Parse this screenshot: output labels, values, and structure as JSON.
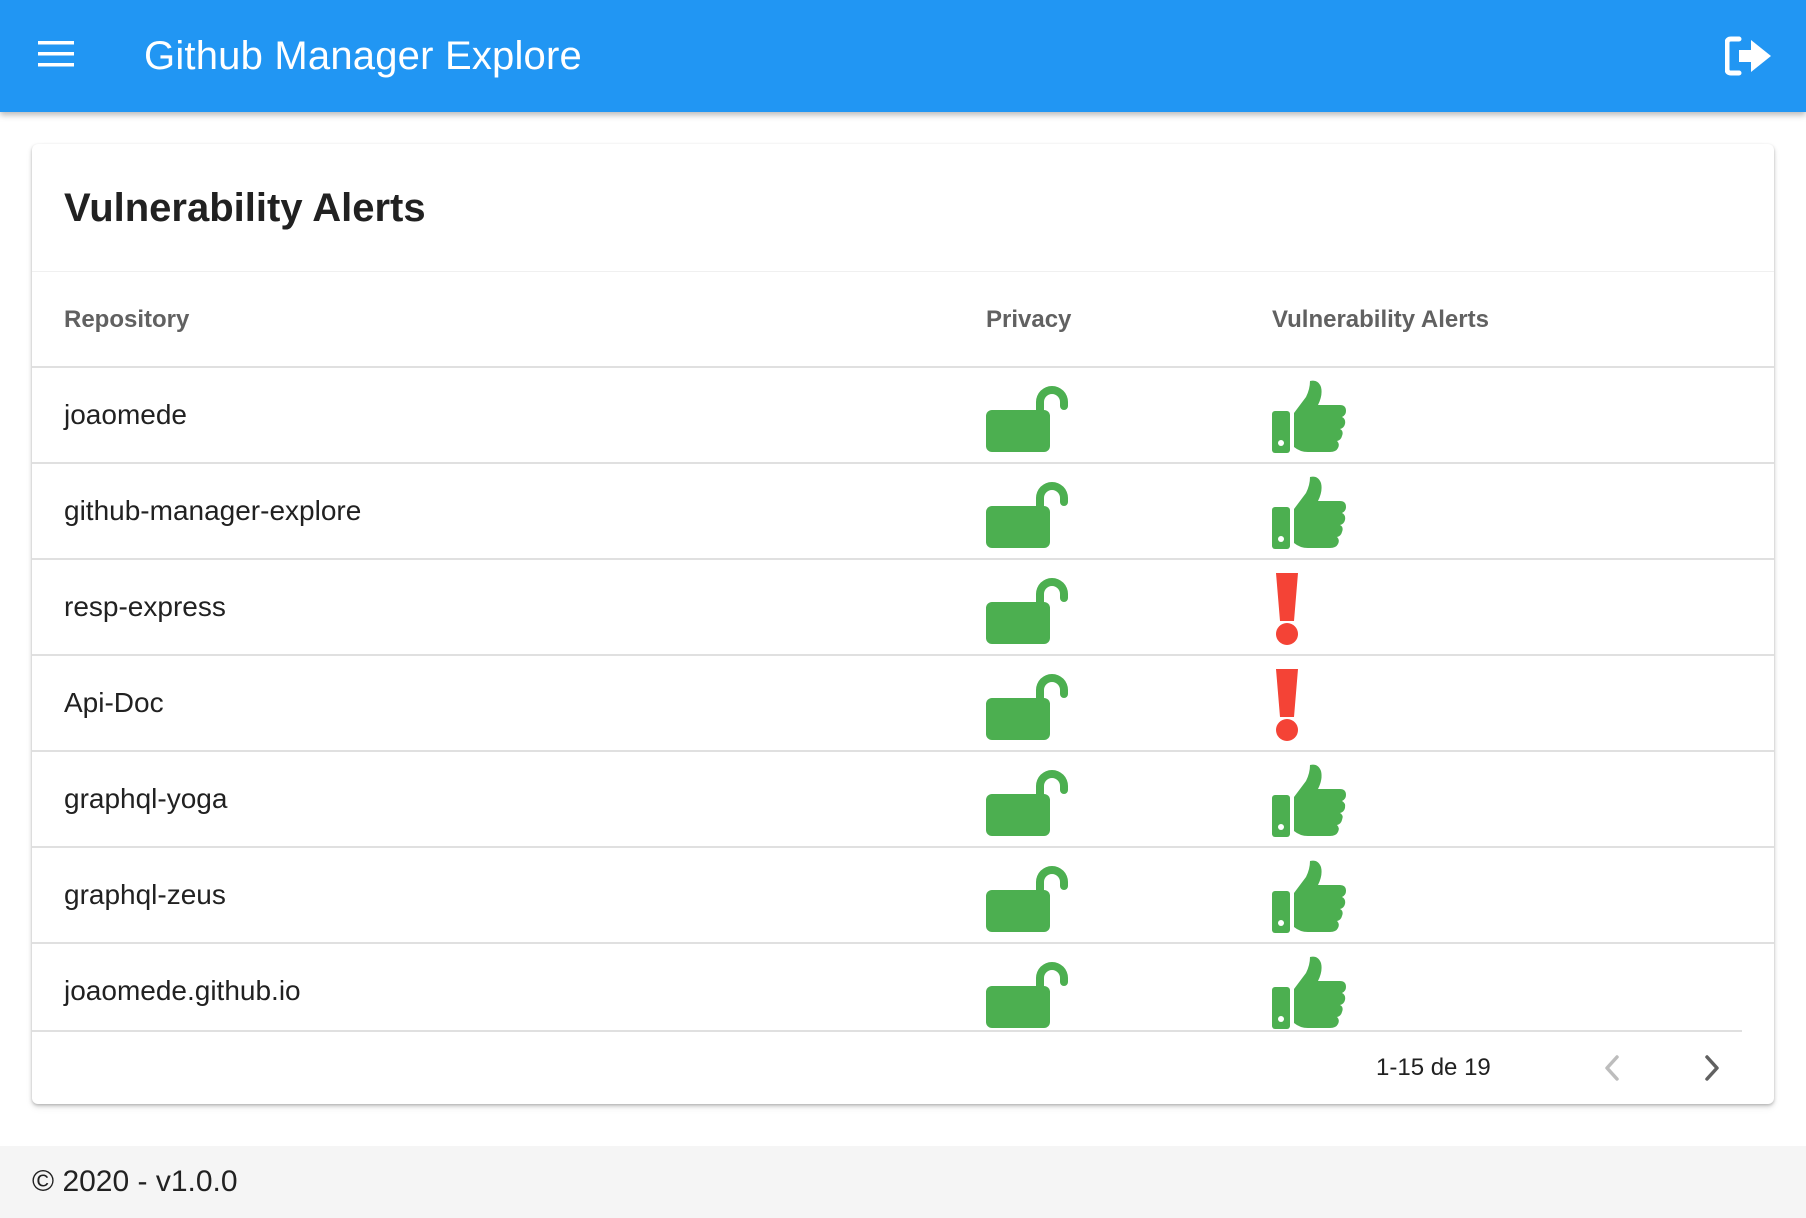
{
  "appbar": {
    "title": "Github Manager Explore",
    "menu_icon": "hamburger-menu-icon",
    "logout_icon": "sign-out-icon",
    "color": "#2196f3"
  },
  "card": {
    "title": "Vulnerability Alerts"
  },
  "table": {
    "headers": {
      "repository": "Repository",
      "privacy": "Privacy",
      "vulnerability": "Vulnerability Alerts"
    },
    "rows": [
      {
        "repository": "joaomede",
        "privacy": "unlock-icon",
        "alert": "thumbs-up-icon"
      },
      {
        "repository": "github-manager-explore",
        "privacy": "unlock-icon",
        "alert": "thumbs-up-icon"
      },
      {
        "repository": "resp-express",
        "privacy": "unlock-icon",
        "alert": "exclamation-icon"
      },
      {
        "repository": "Api-Doc",
        "privacy": "unlock-icon",
        "alert": "exclamation-icon"
      },
      {
        "repository": "graphql-yoga",
        "privacy": "unlock-icon",
        "alert": "thumbs-up-icon"
      },
      {
        "repository": "graphql-zeus",
        "privacy": "unlock-icon",
        "alert": "thumbs-up-icon"
      },
      {
        "repository": "joaomede.github.io",
        "privacy": "unlock-icon",
        "alert": "thumbs-up-icon"
      }
    ],
    "colors": {
      "ok": "#4caf50",
      "alert": "#f44336"
    }
  },
  "pagination": {
    "info": "1-15 de 19",
    "prev_icon": "chevron-left-icon",
    "next_icon": "chevron-right-icon"
  },
  "footer": {
    "text": "© 2020 - v1.0.0"
  }
}
